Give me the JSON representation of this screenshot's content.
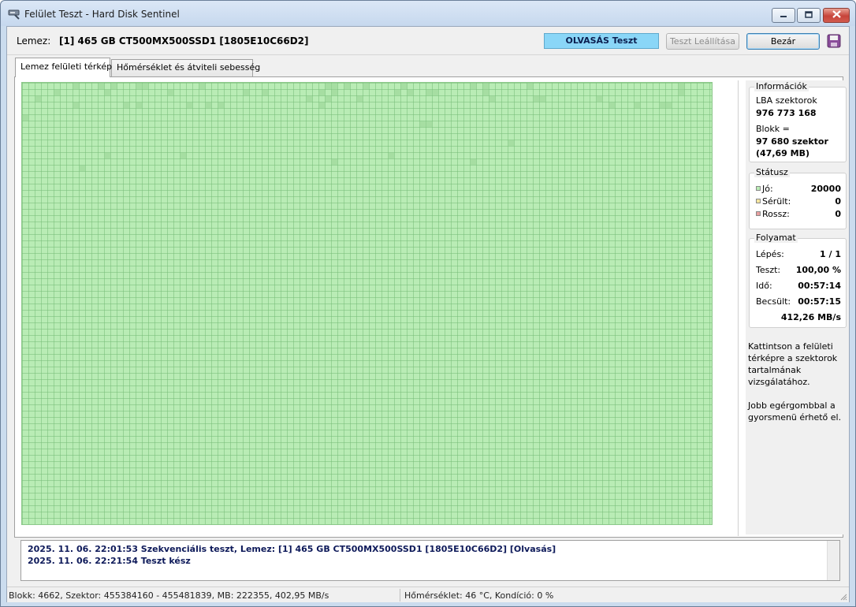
{
  "window": {
    "title": "Felület Teszt - Hard Disk Sentinel"
  },
  "toolbar": {
    "disk_label": "Lemez:",
    "disk_value": "[1] 465 GB  CT500MX500SSD1 [1805E10C66D2]",
    "status_banner": "OLVASÁS Teszt",
    "stop_label": "Teszt Leállítása",
    "close_label": "Bezár"
  },
  "tabs": [
    {
      "label": "Lemez felületi térkép",
      "active": true
    },
    {
      "label": "Hőmérséklet és átviteli sebesség",
      "active": false
    }
  ],
  "info": {
    "title": "Információk",
    "lba_label": "LBA szektorok",
    "lba_value": "976 773 168",
    "block_label": "Blokk =",
    "block_value": "97 680 szektor",
    "block_size": "(47,69 MB)"
  },
  "status": {
    "title": "Státusz",
    "good_label": "Jó:",
    "good_value": "20000",
    "damaged_label": "Sérült:",
    "damaged_value": "0",
    "bad_label": "Rossz:",
    "bad_value": "0"
  },
  "progress": {
    "title": "Folyamat",
    "step_label": "Lépés:",
    "step_value": "1 / 1",
    "test_label": "Teszt:",
    "test_value": "100,00 %",
    "time_label": "Idő:",
    "time_value": "00:57:14",
    "est_label": "Becsült:",
    "est_value": "00:57:15",
    "speed_value": "412,26 MB/s"
  },
  "hint": {
    "text1": "Kattintson a felületi térképre a szektorok tartalmának vizsgálatához.",
    "text2": "Jobb egérgombbal a gyorsmenü érhető el."
  },
  "log": [
    "2025. 11. 06.  22:01:53   Szekvenciális teszt, Lemez: [1] 465 GB  CT500MX500SSD1 [1805E10C66D2] [Olvasás]",
    "2025. 11. 06.  22:21:54   Teszt kész"
  ],
  "statusbar": {
    "left": "Blokk: 4662, Szektor: 455384160 - 455481839, MB: 222355, 402,95 MB/s",
    "right": "Hőmérséklet: 46  °C,  Kondíció: 0 %"
  },
  "colors": {
    "good": "#b9ecb5",
    "damaged": "#f6e6a0",
    "bad": "#e8a0a0",
    "banner": "#8ad6f7"
  }
}
